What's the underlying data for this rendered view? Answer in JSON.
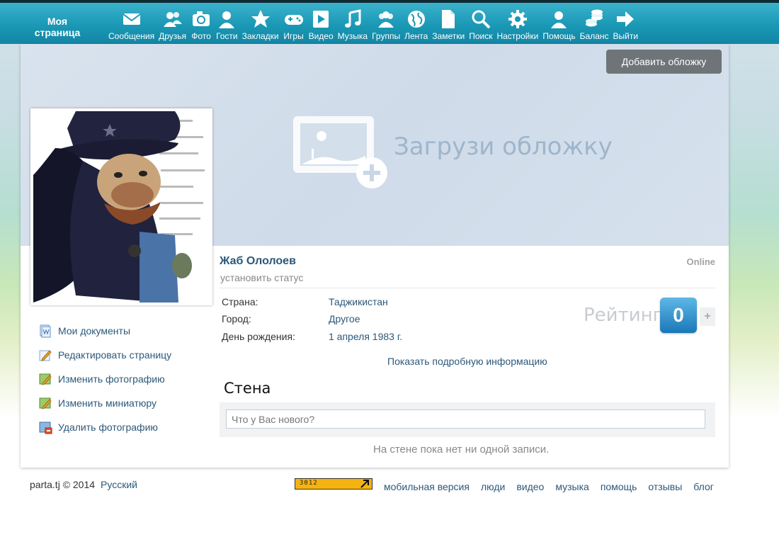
{
  "header": {
    "my_page": "Моя страница",
    "nav": [
      {
        "label": "Сообщения",
        "icon": "envelope-icon"
      },
      {
        "label": "Друзья",
        "icon": "friends-icon"
      },
      {
        "label": "Фото",
        "icon": "camera-icon"
      },
      {
        "label": "Гости",
        "icon": "guest-icon"
      },
      {
        "label": "Закладки",
        "icon": "star-icon"
      },
      {
        "label": "Игры",
        "icon": "gamepad-icon"
      },
      {
        "label": "Видео",
        "icon": "play-icon"
      },
      {
        "label": "Музыка",
        "icon": "music-note-icon"
      },
      {
        "label": "Группы",
        "icon": "group-icon"
      },
      {
        "label": "Лента",
        "icon": "globe-icon"
      },
      {
        "label": "Заметки",
        "icon": "document-icon"
      },
      {
        "label": "Поиск",
        "icon": "magnifier-icon"
      },
      {
        "label": "Настройки",
        "icon": "gear-icon"
      },
      {
        "label": "Помощь",
        "icon": "help-person-icon"
      },
      {
        "label": "Баланс",
        "icon": "coins-icon"
      },
      {
        "label": "Выйти",
        "icon": "arrow-right-icon"
      }
    ]
  },
  "cover": {
    "add_cover": "Добавить обложку",
    "upload_text": "Загрузи обложку"
  },
  "sidebar": {
    "links": [
      {
        "label": "Мои документы",
        "icon": "documents-icon"
      },
      {
        "label": "Редактировать страницу",
        "icon": "pencil-icon"
      },
      {
        "label": "Изменить фотографию",
        "icon": "edit-photo-icon"
      },
      {
        "label": "Изменить миниатюру",
        "icon": "edit-thumbnail-icon"
      },
      {
        "label": "Удалить фотографию",
        "icon": "delete-photo-icon"
      }
    ]
  },
  "profile": {
    "name": "Жаб Ололоев",
    "online": "Online",
    "status_prompt": "установить статус",
    "info": [
      {
        "key": "Страна:",
        "value": "Таджикистан"
      },
      {
        "key": "Город:",
        "value": "Другое"
      },
      {
        "key": "День рождения:",
        "value": "1 апреля 1983 г."
      }
    ],
    "rating_label": "Рейтинг",
    "rating_value": "0",
    "rating_plus": "+",
    "more_info": "Показать подробную информацию"
  },
  "wall": {
    "title": "Стена",
    "placeholder": "Что у Вас нового?",
    "empty": "На стене пока нет ни одной записи."
  },
  "footer": {
    "copyright": "parta.tj © 2014",
    "language": "Русский",
    "counter": "3012",
    "links": [
      "мобильная версия",
      "люди",
      "видео",
      "музыка",
      "помощь",
      "отзывы",
      "блог"
    ]
  },
  "colors": {
    "topbar": "#1a98b5",
    "link": "#2b587a",
    "button": "#6f7478",
    "rating_badge": "#1a78b8"
  }
}
